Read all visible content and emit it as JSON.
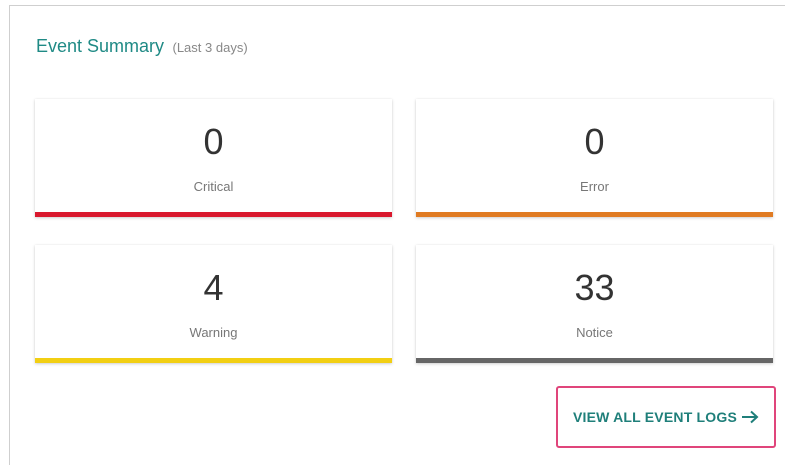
{
  "event_summary": {
    "title": "Event Summary",
    "subtitle": "(Last 3 days)",
    "cards": [
      {
        "count": "0",
        "label": "Critical",
        "color": "#d9182d"
      },
      {
        "count": "0",
        "label": "Error",
        "color": "#e07b22"
      },
      {
        "count": "4",
        "label": "Warning",
        "color": "#f2cf13"
      },
      {
        "count": "33",
        "label": "Notice",
        "color": "#666666"
      }
    ],
    "view_all_label": "VIEW ALL EVENT LOGS",
    "view_all_icon": "arrow-right-icon"
  }
}
